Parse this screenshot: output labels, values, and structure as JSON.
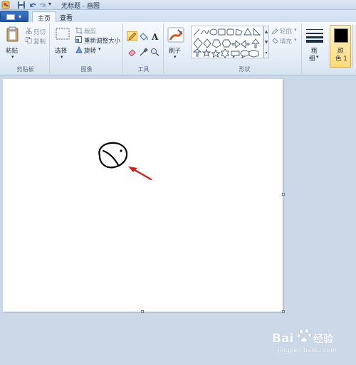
{
  "window": {
    "title": "无标题 - 画图"
  },
  "tabs": {
    "file_icon": "paint-menu-icon",
    "home": "主页",
    "view": "查看"
  },
  "clipboard": {
    "paste": "粘贴",
    "cut": "剪切",
    "copy": "复制",
    "group_label": "剪贴板"
  },
  "image": {
    "select": "选择",
    "crop": "裁剪",
    "resize": "重新调整大小",
    "rotate": "旋转",
    "group_label": "图像"
  },
  "tools": {
    "group_label": "工具",
    "selected": "pencil"
  },
  "brushes": {
    "label": "刷子"
  },
  "shapes": {
    "outline": "轮廓",
    "fill": "填充",
    "group_label": "形状"
  },
  "size": {
    "label_line1": "粗",
    "label_line2": "细"
  },
  "colors": {
    "color1_line1": "颜",
    "color1_line2": "色 1",
    "color1_value": "#000000"
  },
  "watermark": {
    "brand": "Bai",
    "brand_cn": "经验",
    "url": "jingyan.baidu.com"
  }
}
